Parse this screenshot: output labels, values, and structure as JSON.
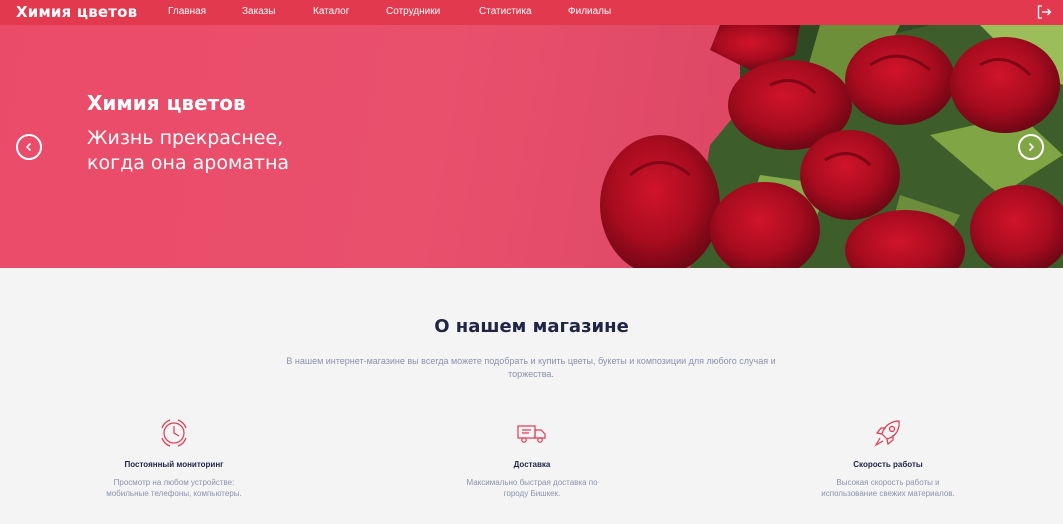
{
  "nav": {
    "brand": "Химия цветов",
    "items": [
      "Главная",
      "Заказы",
      "Каталог",
      "Сотрудники",
      "Статистика",
      "Филиалы"
    ],
    "logout_icon": "logout-icon"
  },
  "hero": {
    "title": "Химия цветов",
    "subtitle": "Жизнь прекраснее, когда она ароматна",
    "prev_icon": "chevron-left-icon",
    "next_icon": "chevron-right-icon"
  },
  "about": {
    "title": "О нашем магазине",
    "text": "В нашем интернет-магазине вы всегда можете подобрать и купить цветы, букеты и композиции для любого случая и торжества."
  },
  "features": [
    {
      "icon": "clock-icon",
      "title": "Постоянный мониторинг",
      "text": "Просмотр на любом устройстве: мобильные телефоны, компьютеры."
    },
    {
      "icon": "truck-icon",
      "title": "Доставка",
      "text": "Максимально быстрая доставка по городу Бишкек."
    },
    {
      "icon": "rocket-icon",
      "title": "Скорость работы",
      "text": "Высокая скорость работы и использование свежих материалов."
    }
  ],
  "colors": {
    "accent": "#e3394f",
    "heading": "#1f2545",
    "muted": "#8a93b0",
    "background": "#f4f4f4"
  }
}
